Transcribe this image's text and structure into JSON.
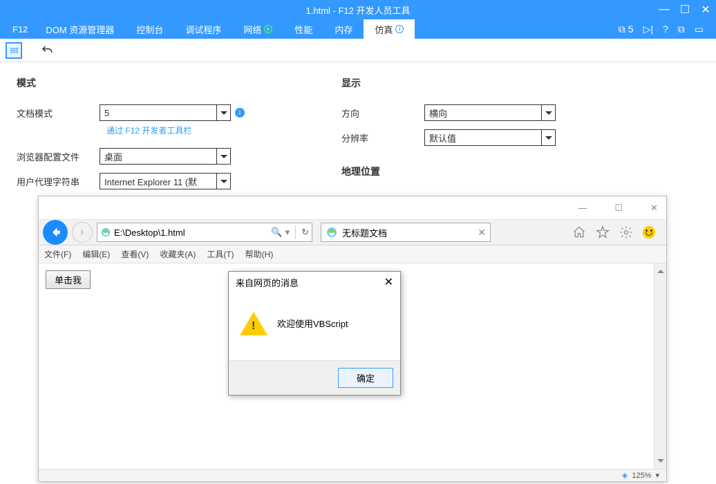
{
  "devtools": {
    "title": "1.html - F12 开发人员工具",
    "tabs": {
      "f12": "F12",
      "dom": "DOM 资源管理器",
      "console": "控制台",
      "debugger": "调试程序",
      "network": "网络",
      "performance": "性能",
      "memory": "内存",
      "emulation": "仿真"
    },
    "right_status_count": "5",
    "emulation": {
      "mode_section": "模式",
      "doc_mode_label": "文档模式",
      "doc_mode_value": "5",
      "doc_mode_hint": "通过 F12 开发者工具栏",
      "browser_profile_label": "浏览器配置文件",
      "browser_profile_value": "桌面",
      "ua_label": "用户代理字符串",
      "ua_value": "Internet Explorer 11 (默",
      "display_section": "显示",
      "orientation_label": "方向",
      "orientation_value": "横向",
      "resolution_label": "分辨率",
      "resolution_value": "默认值",
      "geo_section": "地理位置"
    }
  },
  "ie": {
    "window_controls": {
      "min": "—",
      "max": "☐",
      "close": "✕"
    },
    "address": "E:\\Desktop\\1.html",
    "tab_title": "无标题文档",
    "menus": {
      "file": "文件(F)",
      "edit": "编辑(E)",
      "view": "查看(V)",
      "favorites": "收藏夹(A)",
      "tools": "工具(T)",
      "help": "帮助(H)"
    },
    "page_button": "单击我",
    "zoom": "125%"
  },
  "alert": {
    "title": "来自网页的消息",
    "message": "欢迎使用VBScript",
    "ok": "确定"
  }
}
